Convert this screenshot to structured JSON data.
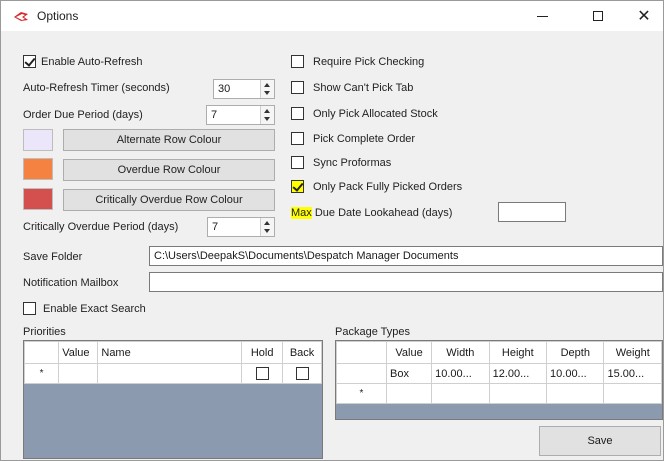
{
  "window": {
    "title": "Options"
  },
  "left": {
    "enable_auto_refresh": {
      "label": "Enable Auto-Refresh",
      "checked": true
    },
    "auto_refresh_timer": {
      "label": "Auto-Refresh Timer (seconds)",
      "value": "30"
    },
    "order_due_period": {
      "label": "Order Due Period (days)",
      "value": "7"
    },
    "alternate_row_colour": {
      "label": "Alternate Row Colour",
      "color": "#ebe6fa"
    },
    "overdue_row_colour": {
      "label": "Overdue Row Colour",
      "color": "#f58240"
    },
    "critically_overdue_row_colour": {
      "label": "Critically Overdue Row Colour",
      "color": "#d4504f"
    },
    "critically_overdue_period": {
      "label": "Critically Overdue Period (days)",
      "value": "7"
    }
  },
  "right": {
    "require_pick_checking": {
      "label": "Require Pick Checking",
      "checked": false
    },
    "show_cant_pick_tab": {
      "label": "Show Can't Pick Tab",
      "checked": false
    },
    "only_pick_allocated_stock": {
      "label": "Only Pick Allocated Stock",
      "checked": false
    },
    "pick_complete_order": {
      "label": "Pick Complete Order",
      "checked": false
    },
    "sync_proformas": {
      "label": "Sync Proformas",
      "checked": false
    },
    "only_pack_fully_picked": {
      "label": "Only Pack Fully Picked Orders",
      "checked": true
    },
    "max_due_date": {
      "label_highlight": "Max",
      "label_rest": " Due Date Lookahead (days)",
      "value": ""
    }
  },
  "save_folder": {
    "label": "Save Folder",
    "value": "C:\\Users\\DeepakS\\Documents\\Despatch Manager Documents"
  },
  "notification_mailbox": {
    "label": "Notification Mailbox",
    "value": ""
  },
  "enable_exact_search": {
    "label": "Enable Exact Search",
    "checked": false
  },
  "priorities": {
    "title": "Priorities",
    "columns": [
      "Value",
      "Name",
      "Hold",
      "Back"
    ],
    "new_row_marker": "*"
  },
  "package_types": {
    "title": "Package Types",
    "columns": [
      "Value",
      "Width",
      "Height",
      "Depth",
      "Weight"
    ],
    "rows": [
      {
        "value": "Box",
        "width": "10.00...",
        "height": "12.00...",
        "depth": "10.00...",
        "weight": "15.00..."
      }
    ],
    "new_row_marker": "*"
  },
  "save_button": {
    "label": "Save"
  },
  "colors": {
    "grid_background": "#8c9ab0",
    "highlight": "#ffff00"
  }
}
